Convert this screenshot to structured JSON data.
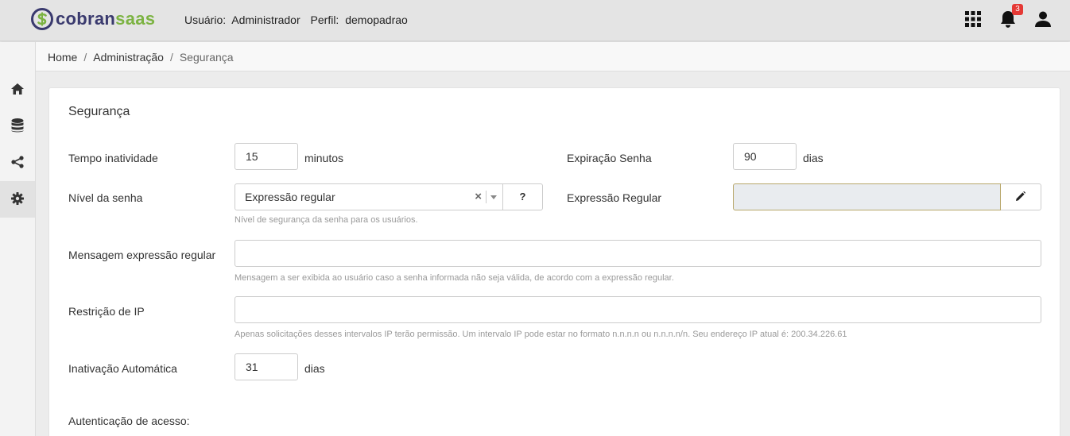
{
  "app": {
    "logo_part1": "cobran",
    "logo_part2": "saas"
  },
  "header": {
    "user_label": "Usuário:",
    "user_value": "Administrador",
    "profile_label": "Perfil:",
    "profile_value": "demopadrao",
    "notifications_count": "3",
    "icons": [
      "apps-grid-icon",
      "bell-icon",
      "user-icon"
    ]
  },
  "sidebar": {
    "items": [
      {
        "icon": "home-icon"
      },
      {
        "icon": "database-icon"
      },
      {
        "icon": "share-icon"
      },
      {
        "icon": "gear-icon",
        "active": true
      }
    ]
  },
  "breadcrumb": {
    "items": [
      "Home",
      "Administração",
      "Segurança"
    ],
    "separator": "/"
  },
  "form": {
    "title": "Segurança",
    "tempo_inatividade": {
      "label": "Tempo inatividade",
      "value": "15",
      "unit": "minutos"
    },
    "expiracao_senha": {
      "label": "Expiração Senha",
      "value": "90",
      "unit": "dias"
    },
    "nivel_senha": {
      "label": "Nível da senha",
      "selected": "Expressão regular",
      "clear": "×",
      "help_button": "?",
      "help": "Nível de segurança da senha para os usuários."
    },
    "expressao_regular": {
      "label": "Expressão Regular",
      "value": ""
    },
    "mensagem": {
      "label": "Mensagem expressão regular",
      "value": "",
      "help": "Mensagem a ser exibida ao usuário caso a senha informada não seja válida, de acordo com a expressão regular."
    },
    "restricao_ip": {
      "label": "Restrição de IP",
      "value": "",
      "help": "Apenas solicitações desses intervalos IP terão permissão. Um intervalo IP pode estar no formato n.n.n.n ou n.n.n.n/n. Seu endereço IP atual é: 200.34.226.61"
    },
    "inativacao": {
      "label": "Inativação Automática",
      "value": "31",
      "unit": "dias"
    },
    "autenticacao": {
      "label": "Autenticação de acesso:"
    }
  },
  "colors": {
    "logo_dark": "#3a3a6e",
    "logo_green": "#7cb342",
    "badge": "#e53935"
  }
}
